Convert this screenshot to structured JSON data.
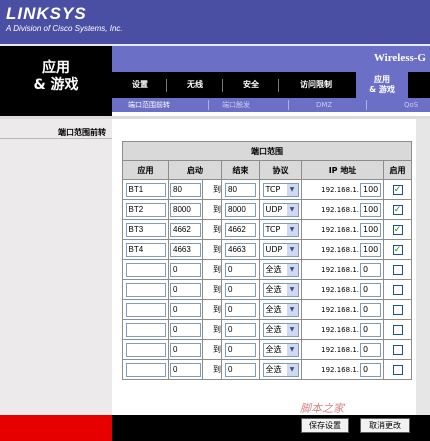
{
  "brand": {
    "logo": "LINKSYS",
    "tagline": "A Division of Cisco Systems, Inc."
  },
  "section_title": [
    "应用",
    "& 游戏"
  ],
  "model": "Wireless-G",
  "tabs": [
    {
      "label": "设置"
    },
    {
      "label": "无线"
    },
    {
      "label": "安全"
    },
    {
      "label": "访问限制"
    }
  ],
  "active_tab": [
    "应用",
    "& 游戏"
  ],
  "subtabs": [
    {
      "label": "端口范围前转"
    },
    {
      "label": "端口触发"
    },
    {
      "label": "DMZ"
    },
    {
      "label": "QoS"
    }
  ],
  "left_title": "端口范围前转",
  "table": {
    "caption": "端口范围",
    "headers": [
      "应用",
      "启动",
      "",
      "结束",
      "协议",
      "IP 地址",
      "启用"
    ],
    "to_label": "到",
    "ip_prefix": "192.168.1.",
    "rows": [
      {
        "app": "BT1",
        "start": "80",
        "end": "80",
        "protocol": "TCP",
        "ip": "100",
        "enabled": "✓"
      },
      {
        "app": "BT2",
        "start": "8000",
        "end": "8000",
        "protocol": "UDP",
        "ip": "100",
        "enabled": "✓"
      },
      {
        "app": "BT3",
        "start": "4662",
        "end": "4662",
        "protocol": "TCP",
        "ip": "100",
        "enabled": "✓"
      },
      {
        "app": "BT4",
        "start": "4663",
        "end": "4663",
        "protocol": "UDP",
        "ip": "100",
        "enabled": "✓"
      },
      {
        "app": "",
        "start": "0",
        "end": "0",
        "protocol": "全选",
        "ip": "0",
        "enabled": ""
      },
      {
        "app": "",
        "start": "0",
        "end": "0",
        "protocol": "全选",
        "ip": "0",
        "enabled": ""
      },
      {
        "app": "",
        "start": "0",
        "end": "0",
        "protocol": "全选",
        "ip": "0",
        "enabled": ""
      },
      {
        "app": "",
        "start": "0",
        "end": "0",
        "protocol": "全选",
        "ip": "0",
        "enabled": ""
      },
      {
        "app": "",
        "start": "0",
        "end": "0",
        "protocol": "全选",
        "ip": "0",
        "enabled": ""
      },
      {
        "app": "",
        "start": "0",
        "end": "0",
        "protocol": "全选",
        "ip": "0",
        "enabled": ""
      }
    ]
  },
  "buttons": {
    "save": "保存设置",
    "cancel": "取消更改"
  },
  "watermark": "脚本之家",
  "icons": {
    "dropdown": "chevron-down-icon",
    "checkbox": "checkbox-icon"
  },
  "colors": {
    "header": "#4a4fa3",
    "tab_active": "#6b6fc6",
    "check": "#1d8a1d"
  }
}
